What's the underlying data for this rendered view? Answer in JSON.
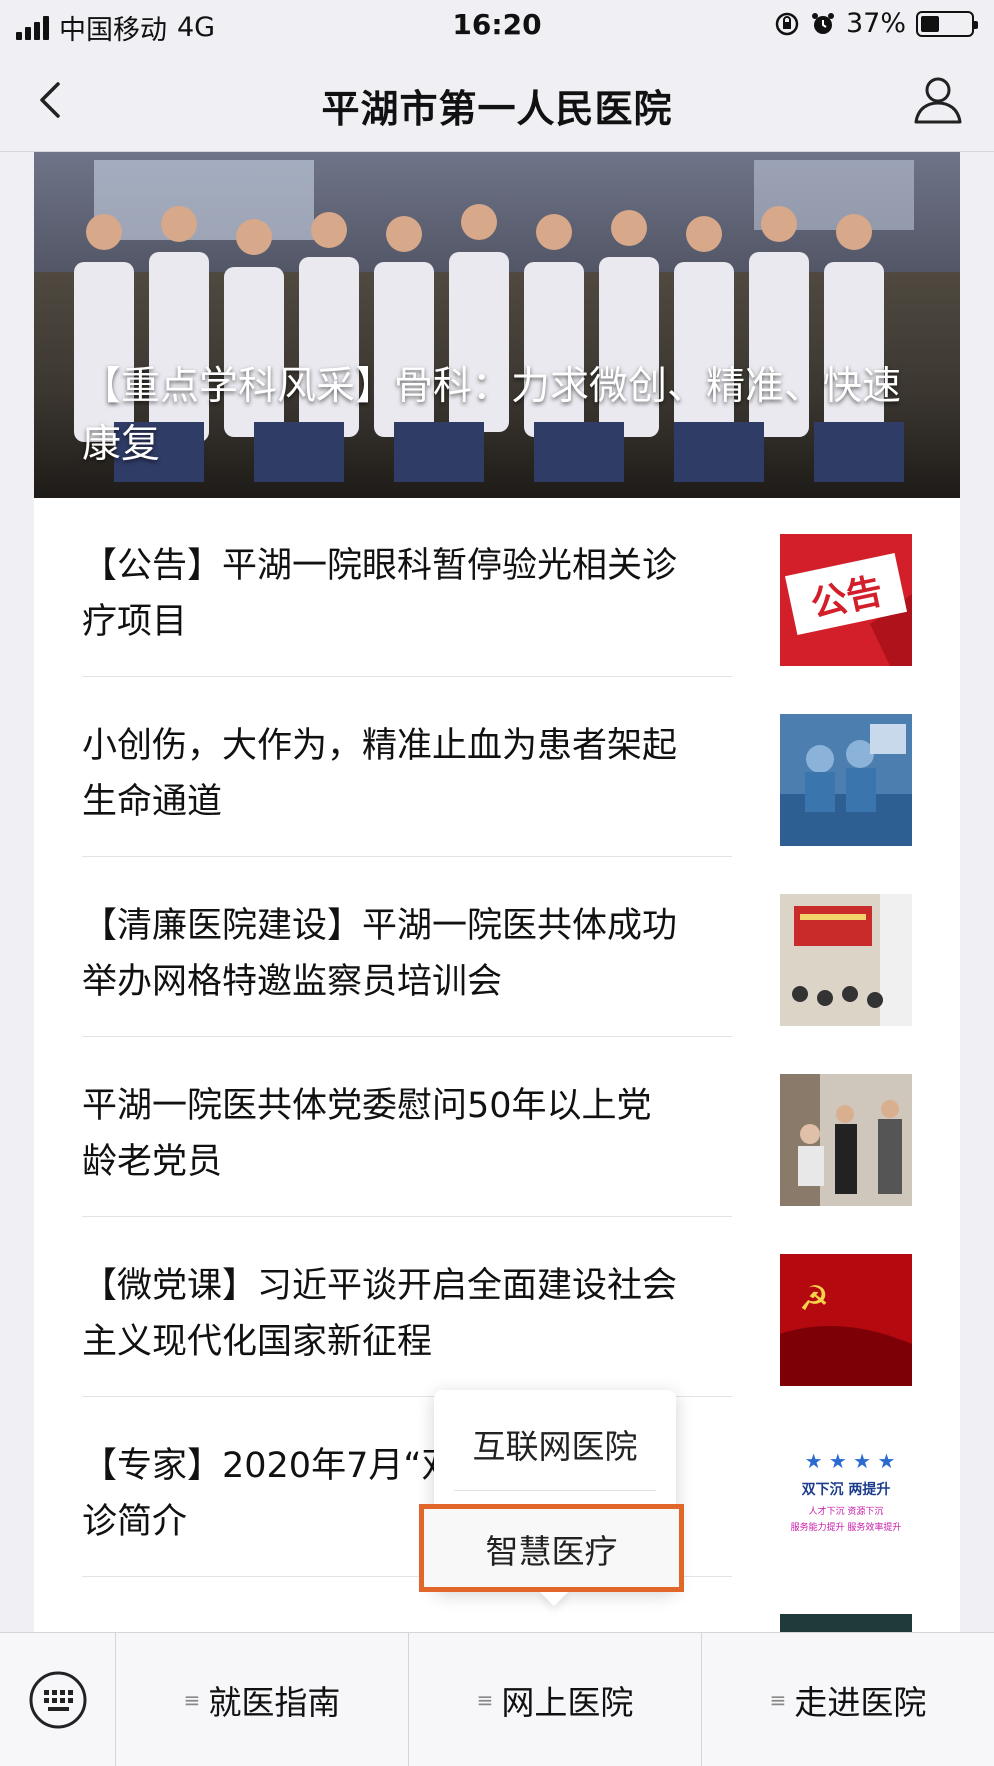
{
  "status_bar": {
    "carrier": "中国移动",
    "network": "4G",
    "time": "16:20",
    "battery": "37%",
    "battery_level": 0.37
  },
  "nav": {
    "title": "平湖市第一人民医院",
    "back_icon": "chevron-left-icon",
    "user_icon": "user-icon"
  },
  "hero": {
    "caption": "【重点学科风采】骨科：力求微创、精准、快速康复"
  },
  "news": [
    {
      "title": "【公告】平湖一院眼科暂停验光相关诊疗项目",
      "thumb_text": "公告"
    },
    {
      "title": "小创伤，大作为，精准止血为患者架起生命通道"
    },
    {
      "title": "【清廉医院建设】平湖一院医共体成功举办网格特邀监察员培训会"
    },
    {
      "title": "平湖一院医共体党委慰问50年以上党龄老党员"
    },
    {
      "title": "【微党课】习近平谈开启全面建设社会主义现代化国家新征程"
    },
    {
      "title": "【专家】2020年7月“双下沉”专家坐诊简介",
      "thumb_text_1": "双下沉 两提升",
      "thumb_text_2": "人才下沉  资源下沉",
      "thumb_text_3": "服务能力提升  服务效率提升"
    }
  ],
  "popup_menu": {
    "items": [
      "互联网医院",
      "智慧医疗"
    ]
  },
  "bottom_menu": {
    "items": [
      "就医指南",
      "网上医院",
      "走进医院"
    ]
  },
  "colors": {
    "highlight": "#e0662a",
    "background": "#efeff4"
  }
}
